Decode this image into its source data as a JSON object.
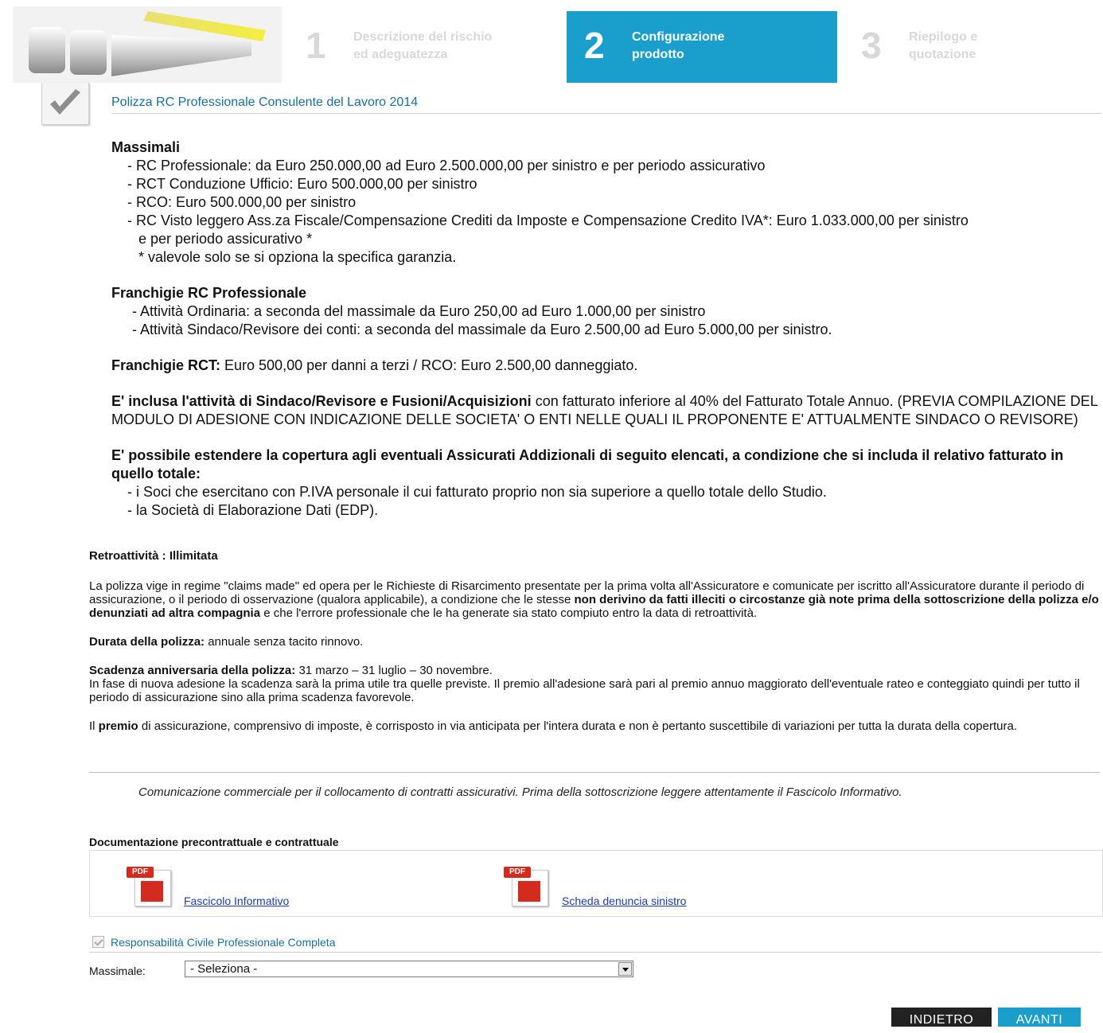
{
  "steps": [
    {
      "num": "1",
      "label_line1": "Descrizione del rischio",
      "label_line2": "ed adeguatezza"
    },
    {
      "num": "2",
      "label_line1": "Configurazione",
      "label_line2": "prodotto"
    },
    {
      "num": "3",
      "label_line1": "Riepilogo e",
      "label_line2": "quotazione"
    }
  ],
  "product": {
    "title": "Polizza RC Professionale Consulente del Lavoro 2014"
  },
  "description": {
    "massimali_heading": "Massimali",
    "massimali_items": [
      "- RC Professionale:  da Euro 250.000,00 ad Euro 2.500.000,00 per sinistro e per periodo assicurativo",
      "- RCT Conduzione Ufficio: Euro 500.000,00 per sinistro",
      "- RCO: Euro 500.000,00 per sinistro",
      "- RC Visto leggero Ass.za Fiscale/Compensazione Crediti da Imposte e Compensazione Credito IVA*:  Euro 1.033.000,00 per sinistro",
      "e per periodo assicurativo *",
      "* valevole solo se si opziona la specifica garanzia."
    ],
    "franchigie_heading": "Franchigie RC Professionale",
    "franchigie_items": [
      "- Attività Ordinaria: a seconda del massimale da Euro 250,00 ad Euro 1.000,00 per sinistro",
      "- Attività Sindaco/Revisore dei conti: a seconda del massimale da Euro 2.500,00 ad Euro 5.000,00 per sinistro."
    ],
    "rct_bold": "Franchigie RCT:",
    "rct_text": " Euro 500,00 per danni a terzi / RCO: Euro 2.500,00 danneggiato.",
    "inclusa_bold": "E' inclusa l'attività di Sindaco/Revisore e Fusioni/Acquisizioni",
    "inclusa_text": " con fatturato inferiore al 40% del Fatturato Totale Annuo. (PREVIA COMPILAZIONE DEL MODULO DI ADESIONE CON INDICAZIONE DELLE SOCIETA' O ENTI NELLE QUALI IL PROPONENTE E' ATTUALMENTE SINDACO O REVISORE)",
    "estendere_bold": "E' possibile estendere la copertura agli eventuali  Assicurati Addizionali  di seguito elencati, a condizione che si includa il relativo fatturato in quello totale:",
    "estendere_items": [
      "- i Soci che esercitano con P.IVA personale il cui fatturato proprio non sia superiore a quello totale dello Studio.",
      "- la Società di Elaborazione Dati (EDP)."
    ]
  },
  "legal": {
    "retro": "Retroattività : Illimitata",
    "claims_a": "La polizza vige in regime \"claims made\" ed opera per le Richieste di Risarcimento presentate per la prima volta all'Assicuratore e comunicate per iscritto all'Assicuratore durante il periodo di assicurazione, o il periodo di osservazione (qualora applicabile), a condizione che le stesse ",
    "claims_bold": "non derivino da fatti illeciti o circostanze già note prima della sottoscrizione della polizza e/o denunziati ad altra compagnia",
    "claims_b": " e che l'errore professionale che le ha generate sia stato compiuto entro la data di retroattività.",
    "durata_bold": "Durata della polizza:",
    "durata_text": " annuale senza tacito rinnovo.",
    "scadenza_bold": "Scadenza anniversaria della polizza:",
    "scadenza_text": "  31 marzo – 31 luglio – 30 novembre.",
    "scadenza_more": "In fase di nuova adesione la scadenza sarà la prima utile tra quelle previste. Il premio all'adesione sarà pari al premio annuo maggiorato dell'eventuale rateo e conteggiato quindi per tutto il periodo di assicurazione sino alla prima scadenza favorevole.",
    "premio_a": "Il ",
    "premio_bold": "premio",
    "premio_b": " di assicurazione, comprensivo di imposte, è corrisposto in via anticipata per l'intera durata e non è pertanto suscettibile di variazioni per tutta la durata della copertura."
  },
  "commercial_note": "Comunicazione commerciale per il collocamento di contratti assicurativi. Prima della sottoscrizione leggere attentamente il Fascicolo Informativo.",
  "documents": {
    "heading": "Documentazione precontrattuale e contrattuale",
    "items": [
      {
        "badge": "PDF",
        "label": "Fascicolo Informativo"
      },
      {
        "badge": "PDF",
        "label": "Scheda denuncia sinistro"
      }
    ]
  },
  "coverage_checkbox": {
    "label": "Responsabilità Civile Professionale Completa",
    "checked": true
  },
  "massimale": {
    "label": "Massimale:",
    "selected": "- Seleziona -"
  },
  "buttons": {
    "back": "INDIETRO",
    "next": "AVANTI"
  },
  "colors": {
    "accent": "#1a9fcc",
    "link": "#1b3ea8",
    "title": "#1a6f9a",
    "pdf_red": "#d52b1e"
  }
}
